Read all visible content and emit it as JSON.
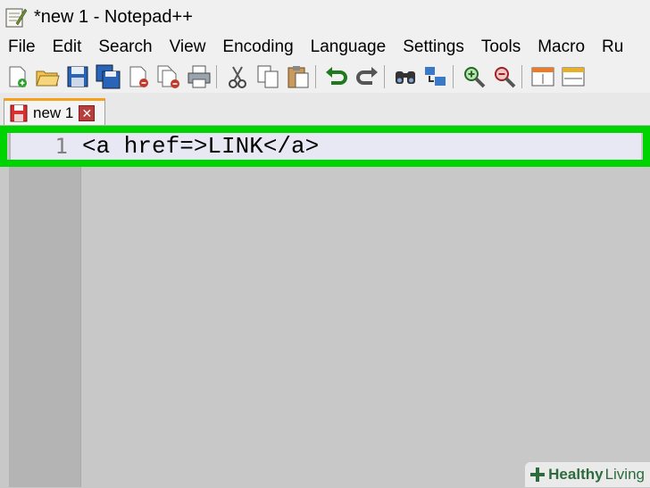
{
  "window": {
    "title": "*new 1 - Notepad++"
  },
  "menu": [
    "File",
    "Edit",
    "Search",
    "View",
    "Encoding",
    "Language",
    "Settings",
    "Tools",
    "Macro",
    "Ru"
  ],
  "toolbar": {
    "icons": [
      "new-file-icon",
      "open-file-icon",
      "save-icon",
      "save-all-icon",
      "close-icon",
      "close-all-icon",
      "print-icon",
      "cut-icon",
      "copy-icon",
      "paste-icon",
      "undo-icon",
      "redo-icon",
      "find-icon",
      "replace-icon",
      "zoom-in-icon",
      "zoom-out-icon",
      "sync-vertical-icon",
      "sync-horizontal-icon"
    ]
  },
  "tab": {
    "label": "new 1",
    "close": "✕"
  },
  "editor": {
    "line_number": "1",
    "line_text": "<a href=>LINK</a>"
  },
  "watermark": {
    "part1": "Healthy",
    "part2": "Living"
  },
  "colors": {
    "highlight": "#00d400",
    "tab_accent": "#f6a11b",
    "watermark": "#2d6a3e"
  }
}
